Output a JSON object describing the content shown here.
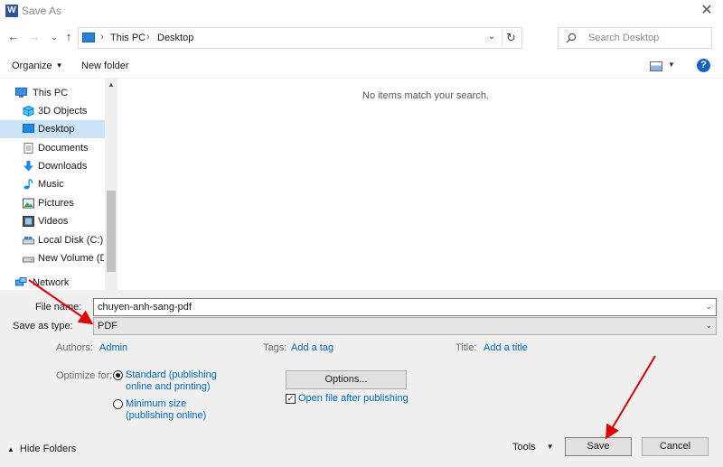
{
  "window": {
    "title": "Save As",
    "app_icon_letter": "W"
  },
  "nav": {
    "breadcrumbs": [
      "This PC",
      "Desktop"
    ],
    "search_placeholder": "Search Desktop"
  },
  "toolbar": {
    "organize": "Organize",
    "new_folder": "New folder",
    "help": "?"
  },
  "sidebar": {
    "items": [
      {
        "label": "This PC",
        "icon": "computer-icon"
      },
      {
        "label": "3D Objects",
        "icon": "cube-icon"
      },
      {
        "label": "Desktop",
        "icon": "desktop-icon",
        "selected": true
      },
      {
        "label": "Documents",
        "icon": "document-icon"
      },
      {
        "label": "Downloads",
        "icon": "download-arrow-icon"
      },
      {
        "label": "Music",
        "icon": "music-note-icon"
      },
      {
        "label": "Pictures",
        "icon": "picture-icon"
      },
      {
        "label": "Videos",
        "icon": "film-icon"
      },
      {
        "label": "Local Disk (C:)",
        "icon": "drive-icon"
      },
      {
        "label": "New Volume (D:)",
        "icon": "drive-icon"
      },
      {
        "label": "Network",
        "icon": "network-icon"
      }
    ]
  },
  "main": {
    "empty_message": "No items match your search."
  },
  "form": {
    "file_name_label": "File name:",
    "file_name_value": "chuyen-anh-sang-pdf",
    "save_type_label": "Save as type:",
    "save_type_value": "PDF",
    "authors_label": "Authors:",
    "authors_value": "Admin",
    "tags_label": "Tags:",
    "tags_value": "Add a tag",
    "title_label": "Title:",
    "title_value": "Add a title",
    "optimize_label": "Optimize for:",
    "opt_standard_line1": "Standard (publishing",
    "opt_standard_line2": "online and printing)",
    "opt_minimum_line1": "Minimum size",
    "opt_minimum_line2": "(publishing online)",
    "options_button": "Options...",
    "open_after_label": "Open file after publishing"
  },
  "footer": {
    "hide_folders": "Hide Folders",
    "tools": "Tools",
    "save": "Save",
    "cancel": "Cancel"
  },
  "colors": {
    "accent": "#0066cc",
    "annotation_arrow": "#e00000",
    "selected_bg": "#cce4f7"
  }
}
